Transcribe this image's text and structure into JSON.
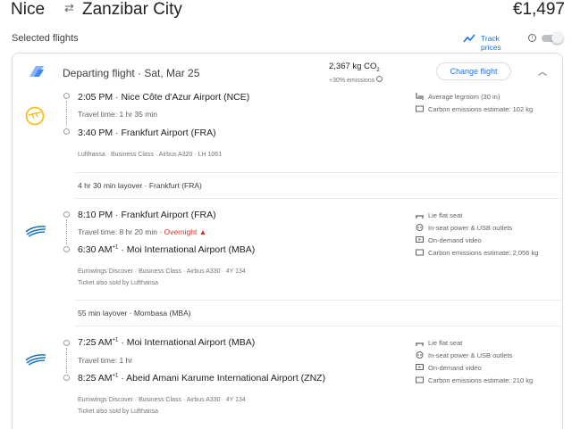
{
  "header": {
    "origin": "Nice",
    "swap_icon": "swap-icon",
    "destination": "Zanzibar City",
    "price": "€1,497"
  },
  "selected_flights": "Selected flights",
  "track": {
    "label": "Track prices",
    "icon": "trend-line-icon",
    "enabled": false
  },
  "summary": {
    "label": "Departing flight · Sat, Mar 25",
    "emissions_main": "2,367 kg CO",
    "emissions_sub": "2",
    "emissions_delta": "+30% emissions",
    "change_button": "Change flight"
  },
  "segments": [
    {
      "airline_icon": "lufthansa-logo-icon",
      "dep_time": "2:05 PM",
      "dep_airport": "Nice Côte d'Azur Airport (NCE)",
      "travel_time": "Travel time: 1 hr 35 min",
      "arr_time": "3:40 PM",
      "arr_airport": "Frankfurt Airport (FRA)",
      "details": "Lufthansa · Business Class · Airbus A320 · LH 1061",
      "amenities": [
        "Average legroom (30 in)",
        "Carbon emissions estimate: 102 kg"
      ]
    },
    {
      "airline_icon": "eurowings-logo-icon",
      "dep_time": "8:10 PM",
      "dep_airport": "Frankfurt Airport (FRA)",
      "travel_time": "Travel time: 8 hr 20 min",
      "overnight": "Overnight",
      "arr_time": "6:30 AM",
      "arr_sup": "+1",
      "arr_airport": "Moi International Airport (MBA)",
      "details": "Eurowings Discover · Business Class · Airbus A330 · 4Y 134",
      "sold_by": "Ticket also sold by Lufthansa",
      "amenities": [
        "Lie flat seat",
        "In-seat power & USB outlets",
        "On-demand video",
        "Carbon emissions estimate: 2,056 kg"
      ]
    },
    {
      "airline_icon": "eurowings-logo-icon",
      "dep_time": "7:25 AM",
      "dep_sup": "+1",
      "dep_airport": "Moi International Airport (MBA)",
      "travel_time": "Travel time: 1 hr",
      "arr_time": "8:25 AM",
      "arr_sup": "+1",
      "arr_airport": "Abeid Amani Karume International Airport (ZNZ)",
      "details": "Eurowings Discover · Business Class · Airbus A330 · 4Y 134",
      "sold_by": "Ticket also sold by Lufthansa",
      "amenities": [
        "Lie flat seat",
        "In-seat power & USB outlets",
        "On-demand video",
        "Carbon emissions estimate: 210 kg"
      ]
    }
  ],
  "layovers": [
    "4 hr 30 min layover · Frankfurt (FRA)",
    "55 min layover · Mombasa (MBA)"
  ],
  "colors": {
    "accent": "#1a73e8",
    "warning": "#d93025",
    "lufthansa": "#f9ba00",
    "eurowings": "#1a73b8"
  }
}
